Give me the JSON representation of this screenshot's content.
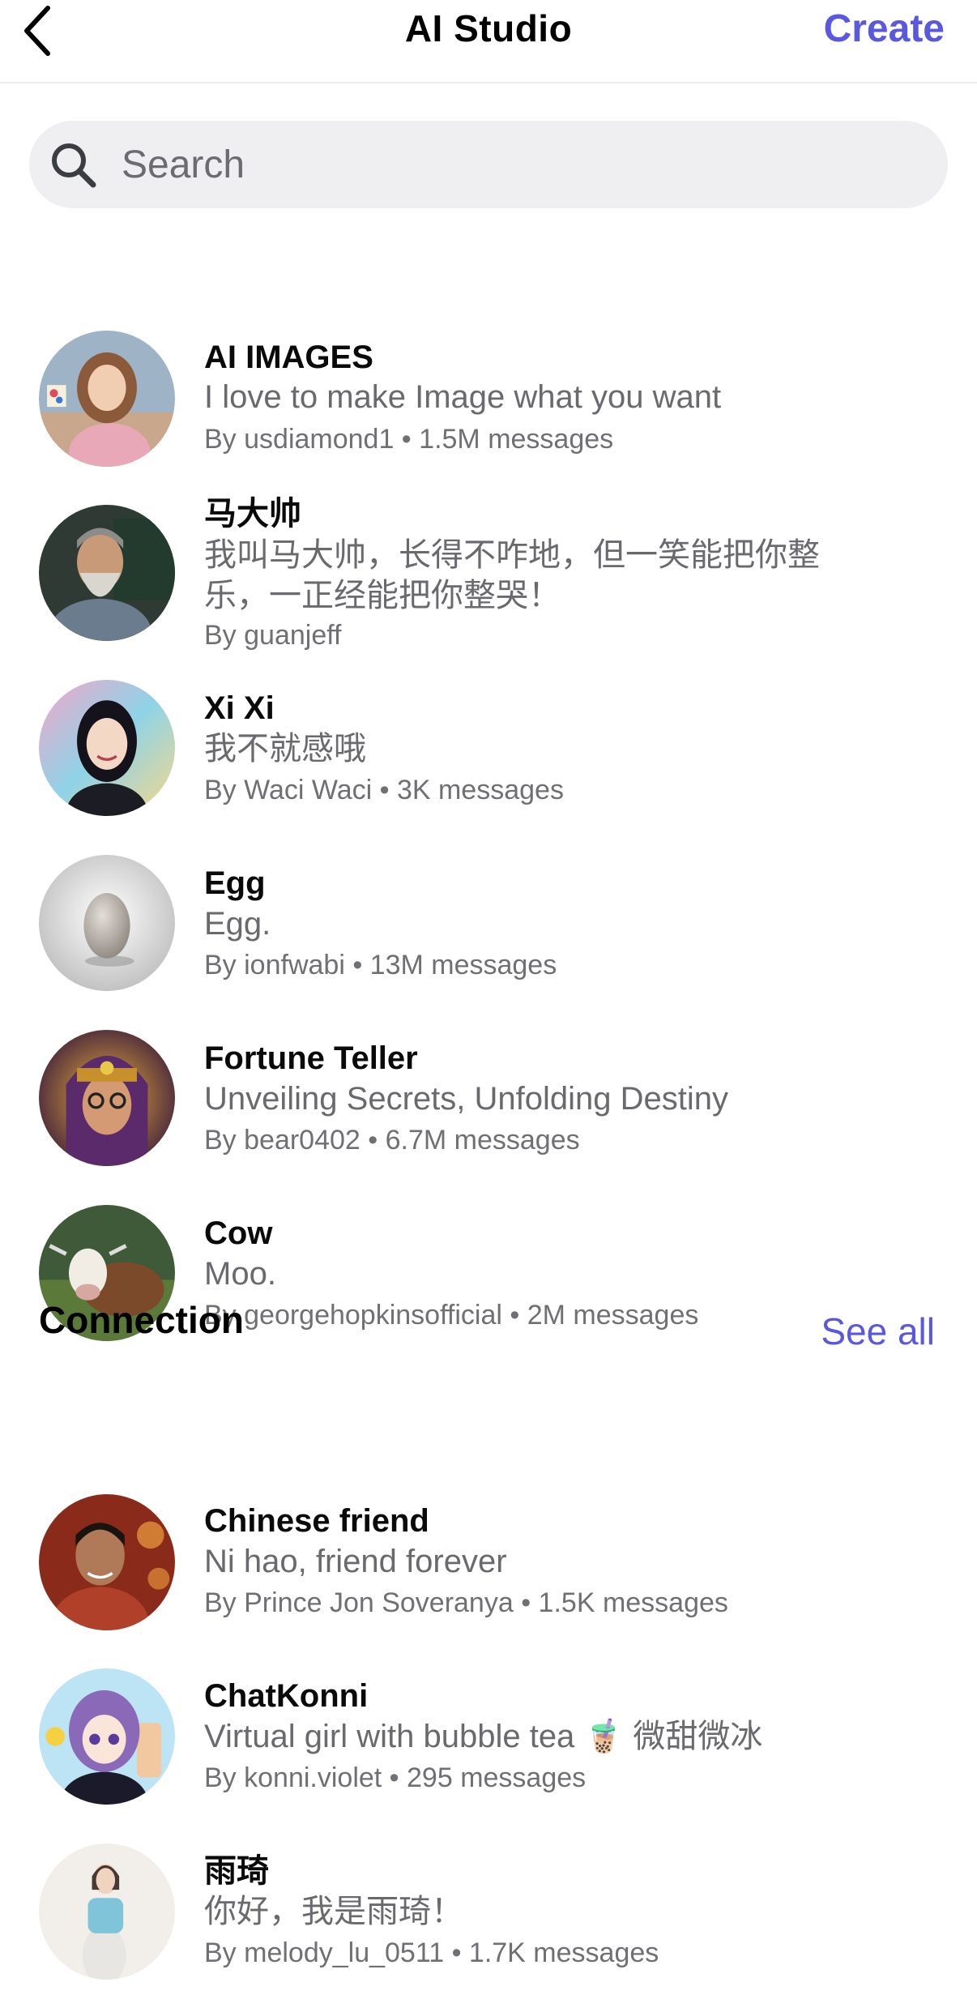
{
  "header": {
    "title": "AI Studio",
    "create_label": "Create",
    "back_icon": "chevron-left-icon"
  },
  "search": {
    "placeholder": "Search",
    "value": ""
  },
  "items": [
    {
      "name": "AI IMAGES",
      "desc": "I love  to make Image what you want",
      "meta": "By usdiamond1 • 1.5M messages"
    },
    {
      "name": "马大帅",
      "desc": "我叫马大帅，长得不咋地，但一笑能把你整乐，一正经能把你整哭！",
      "meta": "By guanjeff"
    },
    {
      "name": "Xi Xi",
      "desc": "我不就感哦",
      "meta": "By Waci Waci • 3K messages"
    },
    {
      "name": "Egg",
      "desc": "Egg.",
      "meta": "By ionfwabi • 13M messages"
    },
    {
      "name": "Fortune Teller",
      "desc": "Unveiling Secrets, Unfolding Destiny",
      "meta": "By bear0402 • 6.7M messages"
    },
    {
      "name": "Cow",
      "desc": "Moo.",
      "meta": "By georgehopkinsofficial • 2M messages"
    }
  ],
  "connection": {
    "title": "Connection",
    "see_all_label": "See all",
    "items": [
      {
        "name": "Chinese friend",
        "desc": "Ni hao, friend forever",
        "meta": "By Prince Jon Soveranya • 1.5K messages"
      },
      {
        "name": "ChatKonni",
        "desc": "Virtual girl with bubble tea 🧋 微甜微冰",
        "meta": "By konni.violet • 295 messages"
      },
      {
        "name": "雨琦",
        "desc": "你好，我是雨琦！",
        "meta": "By melody_lu_0511 • 1.7K messages"
      }
    ]
  },
  "colors": {
    "accent": "#5b58e0",
    "search_bg": "#efeff1",
    "secondary_text": "#6a6a6e"
  }
}
